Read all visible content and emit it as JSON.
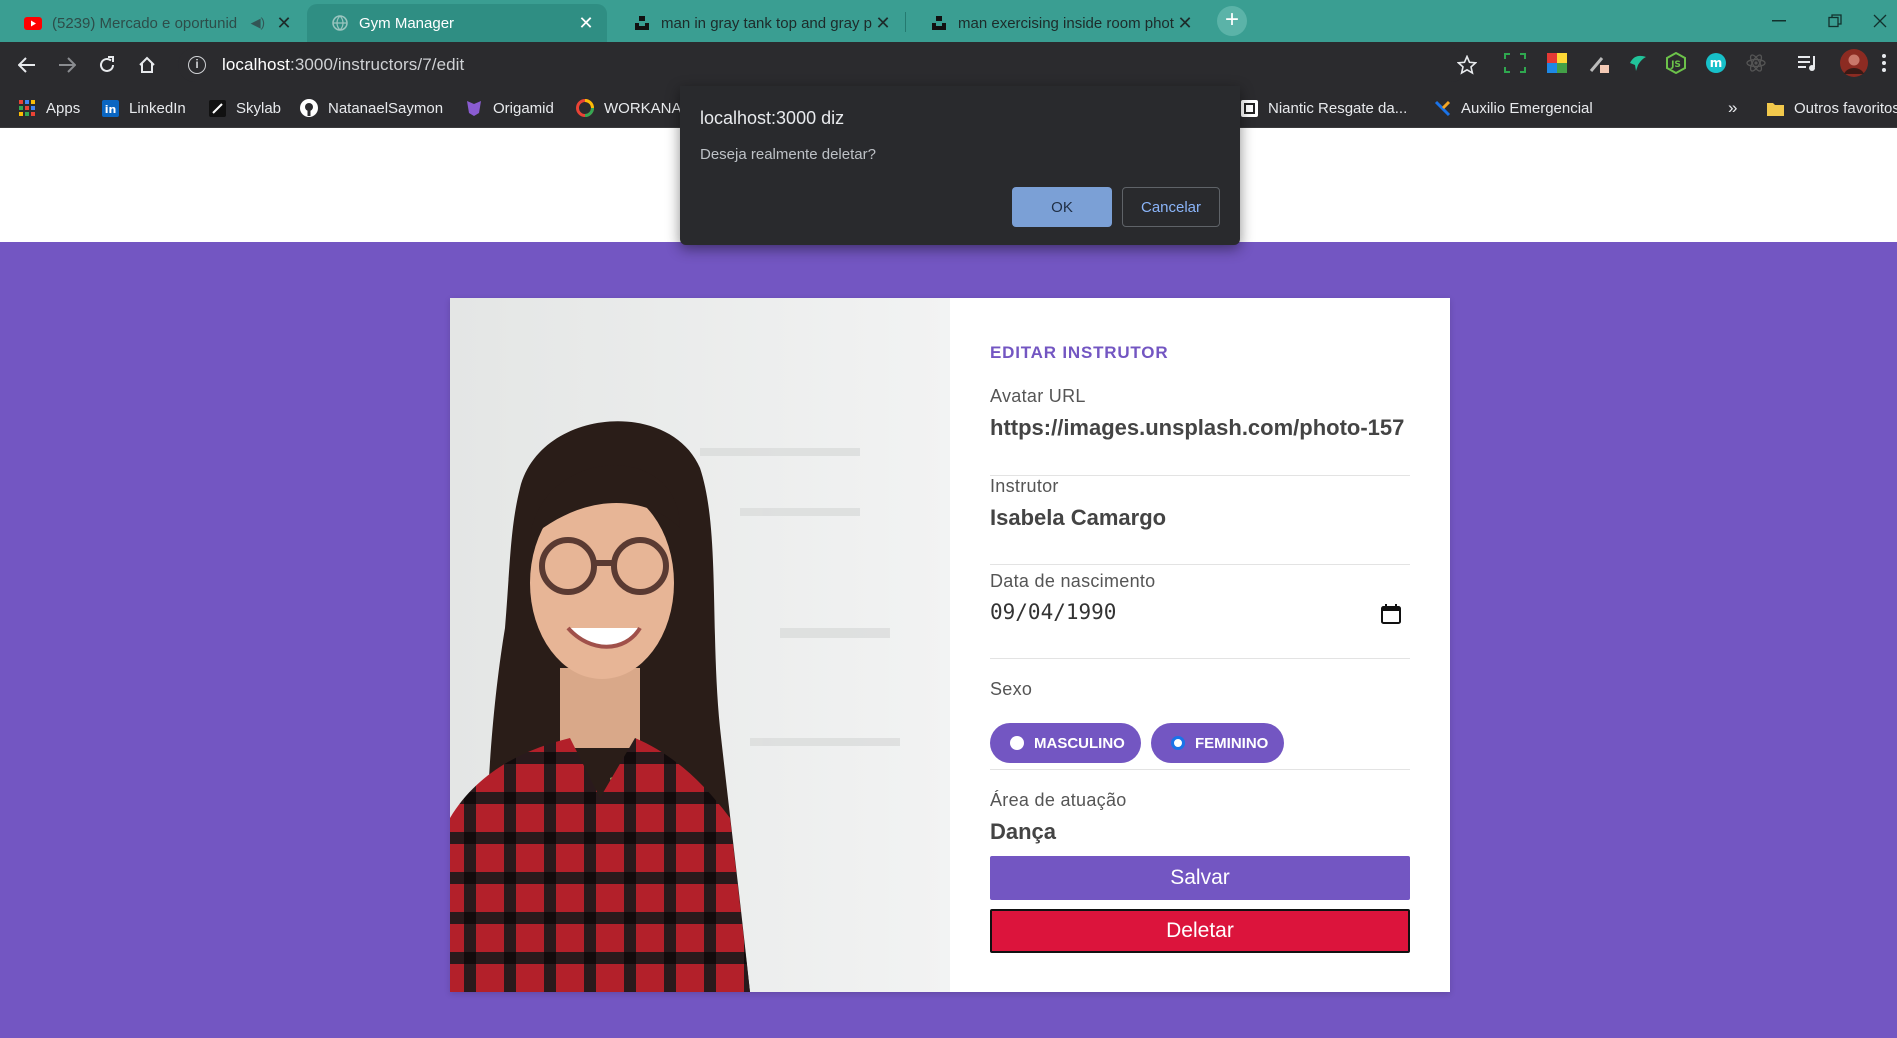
{
  "browser": {
    "tabs": [
      {
        "title": "(5239) Mercado e oportunid",
        "favicon": "youtube-icon",
        "muted": true
      },
      {
        "title": "Gym Manager",
        "favicon": "globe-icon",
        "active": true
      },
      {
        "title": "man in gray tank top and gray p",
        "favicon": "unsplash-icon"
      },
      {
        "title": "man exercising inside room phot",
        "favicon": "unsplash-icon"
      }
    ],
    "new_tab_label": "+",
    "url_host": "localhost",
    "url_path": ":3000/instructors/7/edit",
    "bookmarks": [
      {
        "label": "Apps",
        "icon": "apps-grid-icon"
      },
      {
        "label": "LinkedIn",
        "icon": "linkedin-icon"
      },
      {
        "label": "Skylab",
        "icon": "skylab-icon"
      },
      {
        "label": "NatanaelSaymon",
        "icon": "github-icon"
      },
      {
        "label": "Origamid",
        "icon": "origamid-icon"
      },
      {
        "label": "WORKANA",
        "icon": "workana-icon"
      },
      {
        "label": "Niantic Resgate da...",
        "icon": "niantic-icon"
      },
      {
        "label": "Auxilio Emergencial",
        "icon": "caixa-icon"
      }
    ],
    "bookmarks_overflow": "»",
    "other_bookmarks": "Outros favoritos"
  },
  "dialog": {
    "title": "localhost:3000 diz",
    "message": "Deseja realmente deletar?",
    "ok_label": "OK",
    "cancel_label": "Cancelar"
  },
  "form": {
    "title": "EDITAR INSTRUTOR",
    "avatar_label": "Avatar URL",
    "avatar_value": "https://images.unsplash.com/photo-157",
    "name_label": "Instrutor",
    "name_value": "Isabela Camargo",
    "birth_label": "Data de nascimento",
    "birth_value": "09/04/1990",
    "gender_label": "Sexo",
    "gender_options": [
      {
        "label": "MASCULINO",
        "checked": false
      },
      {
        "label": "FEMININO",
        "checked": true
      }
    ],
    "services_label": "Área de atuação",
    "services_value": "Dança",
    "save_label": "Salvar",
    "delete_label": "Deletar"
  },
  "colors": {
    "accent": "#7356c2",
    "danger": "#dc143c",
    "tabbar": "#3a9e92"
  }
}
